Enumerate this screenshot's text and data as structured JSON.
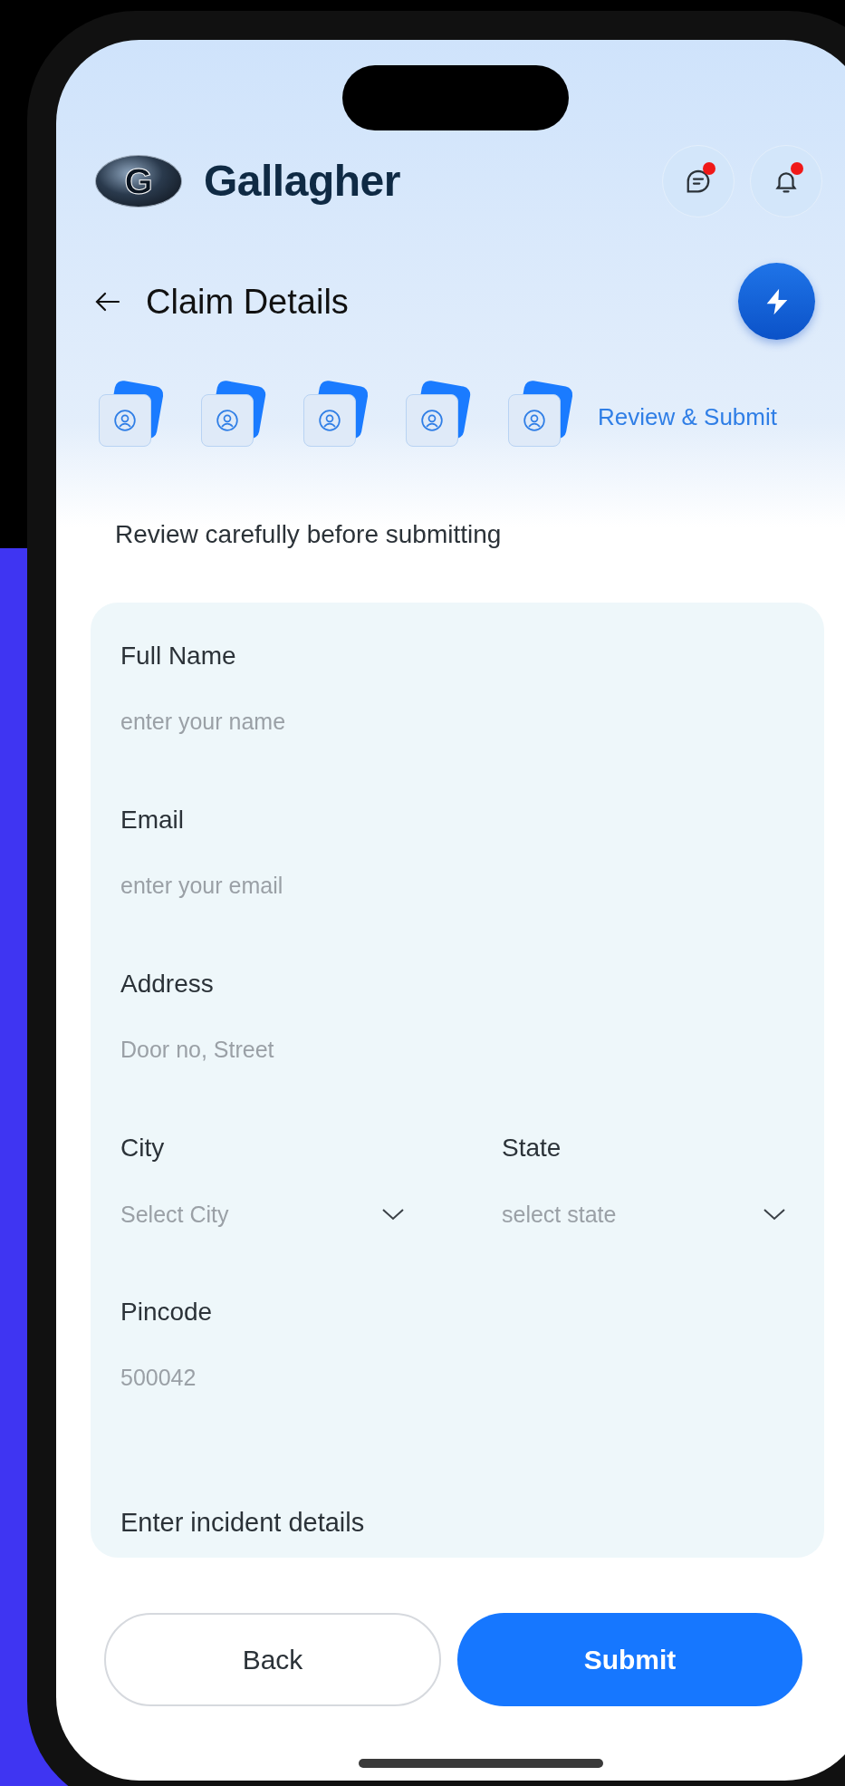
{
  "brand": {
    "mark": "G",
    "name": "Gallagher"
  },
  "header_icons": [
    {
      "kind": "chat",
      "badge": true
    },
    {
      "kind": "bell",
      "badge": true
    }
  ],
  "page": {
    "title": "Claim Details"
  },
  "steps": [
    {
      "kind": "icon"
    },
    {
      "kind": "icon"
    },
    {
      "kind": "icon"
    },
    {
      "kind": "icon"
    },
    {
      "kind": "icon"
    },
    {
      "kind": "label",
      "label": "Review & Submit"
    }
  ],
  "intro": "Review carefully before submitting",
  "form": {
    "fields": [
      {
        "kind": "text",
        "label": "Full Name",
        "placeholder": "enter your name"
      },
      {
        "kind": "text",
        "label": "Email",
        "placeholder": "enter your email"
      },
      {
        "kind": "text",
        "label": "Address",
        "placeholder": "Door no, Street"
      },
      {
        "kind": "row",
        "fields": [
          {
            "kind": "select",
            "label": "City",
            "placeholder": "Select City"
          },
          {
            "kind": "select",
            "label": "State",
            "placeholder": "select state"
          }
        ]
      },
      {
        "kind": "text",
        "label": "Pincode",
        "placeholder": "500042"
      }
    ],
    "section_title": "Enter incident details"
  },
  "buttons": [
    {
      "kind": "secondary",
      "label": "Back"
    },
    {
      "kind": "primary",
      "label": "Submit"
    }
  ]
}
